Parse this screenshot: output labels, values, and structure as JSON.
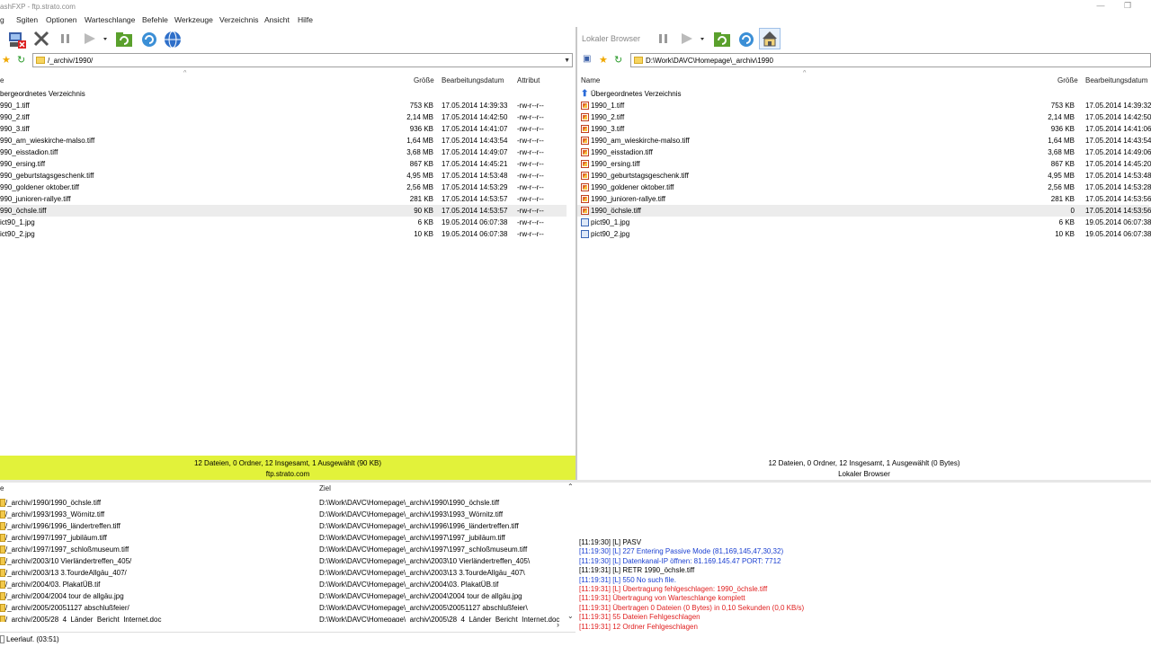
{
  "window": {
    "title": "ashFXP - ftp.strato.com",
    "minimize": "—",
    "restore": "❐"
  },
  "menu": [
    "g",
    "Sgiten",
    "Optionen",
    "Warteschlange",
    "Befehle",
    "Werkzeuge",
    "Verzeichnis",
    "Ansicht",
    "Hilfe"
  ],
  "toolbar_right": {
    "label": "Lokaler Browser"
  },
  "left_pane": {
    "path": "/_archiv/1990/",
    "headers": {
      "name": "e",
      "size": "Größe",
      "date": "Bearbeitungsdatum",
      "attr": "Attribut"
    },
    "parent": "bergeordnetes Verzeichnis",
    "files": [
      {
        "name": "990_1.tiff",
        "size": "753 KB",
        "date": "17.05.2014 14:39:33",
        "attr": "-rw-r--r--"
      },
      {
        "name": "990_2.tiff",
        "size": "2,14 MB",
        "date": "17.05.2014 14:42:50",
        "attr": "-rw-r--r--"
      },
      {
        "name": "990_3.tiff",
        "size": "936 KB",
        "date": "17.05.2014 14:41:07",
        "attr": "-rw-r--r--"
      },
      {
        "name": "990_am_wieskirche-malso.tiff",
        "size": "1,64 MB",
        "date": "17.05.2014 14:43:54",
        "attr": "-rw-r--r--"
      },
      {
        "name": "990_eisstadion.tiff",
        "size": "3,68 MB",
        "date": "17.05.2014 14:49:07",
        "attr": "-rw-r--r--"
      },
      {
        "name": "990_ersing.tiff",
        "size": "867 KB",
        "date": "17.05.2014 14:45:21",
        "attr": "-rw-r--r--"
      },
      {
        "name": "990_geburtstagsgeschenk.tiff",
        "size": "4,95 MB",
        "date": "17.05.2014 14:53:48",
        "attr": "-rw-r--r--"
      },
      {
        "name": "990_goldener oktober.tiff",
        "size": "2,56 MB",
        "date": "17.05.2014 14:53:29",
        "attr": "-rw-r--r--"
      },
      {
        "name": "990_junioren-rallye.tiff",
        "size": "281 KB",
        "date": "17.05.2014 14:53:57",
        "attr": "-rw-r--r--"
      },
      {
        "name": "990_öchsle.tiff",
        "size": "90 KB",
        "date": "17.05.2014 14:53:57",
        "attr": "-rw-r--r--"
      },
      {
        "name": "ict90_1.jpg",
        "size": "6 KB",
        "date": "19.05.2014 06:07:38",
        "attr": "-rw-r--r--"
      },
      {
        "name": "ict90_2.jpg",
        "size": "10 KB",
        "date": "19.05.2014 06:07:38",
        "attr": "-rw-r--r--"
      }
    ],
    "status1": "12 Dateien, 0 Ordner, 12 Insgesamt, 1 Ausgewählt (90 KB)",
    "status2": "ftp.strato.com"
  },
  "right_pane": {
    "path": "D:\\Work\\DAVC\\Homepage\\_archiv\\1990",
    "headers": {
      "name": "Name",
      "size": "Größe",
      "date": "Bearbeitungsdatum"
    },
    "parent": "Übergeordnetes Verzeichnis",
    "files": [
      {
        "name": "1990_1.tiff",
        "size": "753 KB",
        "date": "17.05.2014 14:39:32",
        "type": "tiff"
      },
      {
        "name": "1990_2.tiff",
        "size": "2,14 MB",
        "date": "17.05.2014 14:42:50",
        "type": "tiff"
      },
      {
        "name": "1990_3.tiff",
        "size": "936 KB",
        "date": "17.05.2014 14:41:06",
        "type": "tiff"
      },
      {
        "name": "1990_am_wieskirche-malso.tiff",
        "size": "1,64 MB",
        "date": "17.05.2014 14:43:54",
        "type": "tiff"
      },
      {
        "name": "1990_eisstadion.tiff",
        "size": "3,68 MB",
        "date": "17.05.2014 14:49:06",
        "type": "tiff"
      },
      {
        "name": "1990_ersing.tiff",
        "size": "867 KB",
        "date": "17.05.2014 14:45:20",
        "type": "tiff"
      },
      {
        "name": "1990_geburtstagsgeschenk.tiff",
        "size": "4,95 MB",
        "date": "17.05.2014 14:53:48",
        "type": "tiff"
      },
      {
        "name": "1990_goldener oktober.tiff",
        "size": "2,56 MB",
        "date": "17.05.2014 14:53:28",
        "type": "tiff"
      },
      {
        "name": "1990_junioren-rallye.tiff",
        "size": "281 KB",
        "date": "17.05.2014 14:53:56",
        "type": "tiff"
      },
      {
        "name": "1990_öchsle.tiff",
        "size": "0",
        "date": "17.05.2014 14:53:56",
        "type": "tiff"
      },
      {
        "name": "pict90_1.jpg",
        "size": "6 KB",
        "date": "19.05.2014 06:07:38",
        "type": "jpg"
      },
      {
        "name": "pict90_2.jpg",
        "size": "10 KB",
        "date": "19.05.2014 06:07:38",
        "type": "jpg"
      }
    ],
    "status1": "12 Dateien, 0 Ordner, 12 Insgesamt, 1 Ausgewählt (0 Bytes)",
    "status2": "Lokaler Browser"
  },
  "queue": {
    "headers": {
      "name": "e",
      "target": "Ziel"
    },
    "items": [
      {
        "src": "/_archiv/1990/1990_öchsle.tiff",
        "dst": "D:\\Work\\DAVC\\Homepage\\_archiv\\1990\\1990_öchsle.tiff"
      },
      {
        "src": "/_archiv/1993/1993_Wörnitz.tiff",
        "dst": "D:\\Work\\DAVC\\Homepage\\_archiv\\1993\\1993_Wörnitz.tiff"
      },
      {
        "src": "/_archiv/1996/1996_ländertreffen.tiff",
        "dst": "D:\\Work\\DAVC\\Homepage\\_archiv\\1996\\1996_ländertreffen.tiff"
      },
      {
        "src": "/_archiv/1997/1997_jubiläum.tiff",
        "dst": "D:\\Work\\DAVC\\Homepage\\_archiv\\1997\\1997_jubiläum.tiff"
      },
      {
        "src": "/_archiv/1997/1997_schloßmuseum.tiff",
        "dst": "D:\\Work\\DAVC\\Homepage\\_archiv\\1997\\1997_schloßmuseum.tiff"
      },
      {
        "src": "/_archiv/2003/10 Vierländertreffen_405/",
        "dst": "D:\\Work\\DAVC\\Homepage\\_archiv\\2003\\10 Vierländertreffen_405\\"
      },
      {
        "src": "/_archiv/2003/13 3.TourdeAllgäu_407/",
        "dst": "D:\\Work\\DAVC\\Homepage\\_archiv\\2003\\13 3.TourdeAllgäu_407\\"
      },
      {
        "src": "/_archiv/2004/03. PlakatÜB.tif",
        "dst": "D:\\Work\\DAVC\\Homepage\\_archiv\\2004\\03. PlakatÜB.tif"
      },
      {
        "src": "/_archiv/2004/2004 tour de allgäu.jpg",
        "dst": "D:\\Work\\DAVC\\Homepage\\_archiv\\2004\\2004 tour de allgäu.jpg"
      },
      {
        "src": "/_archiv/2005/20051127 abschlußfeier/",
        "dst": "D:\\Work\\DAVC\\Homepage\\_archiv\\2005\\20051127 abschlußfeier\\"
      },
      {
        "src": "/_archiv/2005/28_4_Länder_Bericht_Internet.doc",
        "dst": "D:\\Work\\DAVC\\Homepage\\_archiv\\2005\\28_4_Länder_Bericht_Internet.doc"
      }
    ]
  },
  "log": [
    {
      "text": "[11:19:30] [L] PASV",
      "color": "#000000"
    },
    {
      "text": "[11:19:30] [L] 227 Entering Passive Mode (81,169,145,47,30,32)",
      "color": "#1a3fd1"
    },
    {
      "text": "[11:19:30] [L] Datenkanal-IP öffnen: 81.169.145.47 PORT: 7712",
      "color": "#1a3fd1"
    },
    {
      "text": "[11:19:31] [L] RETR 1990_öchsle.tiff",
      "color": "#000000"
    },
    {
      "text": "[11:19:31] [L] 550 No such file.",
      "color": "#1a3fd1"
    },
    {
      "text": "[11:19:31] [L] Übertragung fehlgeschlagen: 1990_öchsle.tiff",
      "color": "#e02020"
    },
    {
      "text": "[11:19:31] Übertragung von Warteschlange komplett",
      "color": "#e02020"
    },
    {
      "text": "[11:19:31] Übertragen 0 Dateien (0 Bytes) in 0,10 Sekunden (0,0 KB/s)",
      "color": "#e02020"
    },
    {
      "text": "[11:19:31] 55 Dateien Fehlgeschlagen",
      "color": "#e02020"
    },
    {
      "text": "[11:19:31] 12 Ordner Fehlgeschlagen",
      "color": "#e02020"
    }
  ],
  "statusbar": {
    "text": "Leerlauf. (03:51)"
  },
  "colors": {
    "selected_status_bg": "#e2f23a",
    "log_blue": "#1a3fd1",
    "log_red": "#e02020"
  }
}
